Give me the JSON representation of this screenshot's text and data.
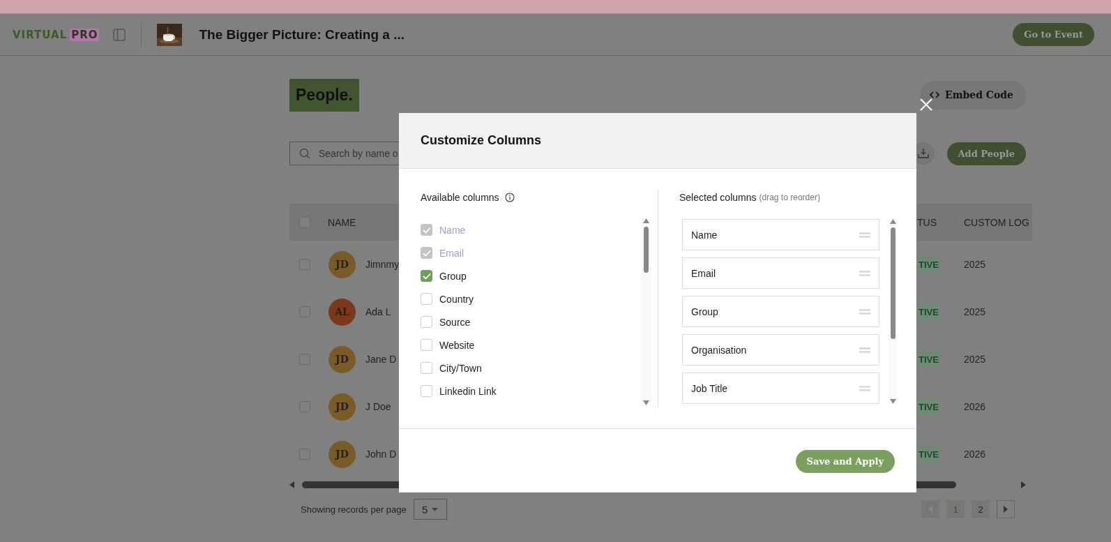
{
  "header": {
    "logo": {
      "primary": "VIRTUAL",
      "secondary": "PRO"
    },
    "event_title": "The Bigger Picture: Creating a ...",
    "go_to_event": "Go to Event"
  },
  "page": {
    "title": "People.",
    "embed_code": "Embed Code",
    "search": {
      "placeholder": "Search by name o"
    },
    "add_people": "Add People"
  },
  "table": {
    "select_all_checked": false,
    "columns": [
      "NAME",
      "TUS",
      "CUSTOM LOG"
    ],
    "rows": [
      {
        "checked": false,
        "initials": "JD",
        "name": "Jimnmy",
        "color": "#7a5a26",
        "status": "TIVE",
        "custom_log": "2025"
      },
      {
        "checked": false,
        "initials": "AL",
        "name": "Ada L",
        "color": "#7a391b",
        "status": "TIVE",
        "custom_log": "2025"
      },
      {
        "checked": false,
        "initials": "JD",
        "name": "Jane D",
        "color": "#7a5a26",
        "status": "TIVE",
        "custom_log": "2025"
      },
      {
        "checked": false,
        "initials": "JD",
        "name": "J Doe",
        "color": "#7a5a26",
        "status": "TIVE",
        "custom_log": "2026"
      },
      {
        "checked": false,
        "initials": "JD",
        "name": "John D",
        "color": "#7a5a26",
        "status": "TIVE",
        "custom_log": "2026"
      }
    ]
  },
  "pagination": {
    "label": "Showing records per page",
    "per_page": "5",
    "pages": [
      {
        "label": "1",
        "selected": true
      },
      {
        "label": "2",
        "selected": false
      }
    ]
  },
  "modal": {
    "title": "Customize Columns",
    "available": {
      "heading": "Available columns",
      "items": [
        {
          "label": "Name",
          "checked": true,
          "disabled": true
        },
        {
          "label": "Email",
          "checked": true,
          "disabled": true
        },
        {
          "label": "Group",
          "checked": true,
          "disabled": false
        },
        {
          "label": "Country",
          "checked": false,
          "disabled": false
        },
        {
          "label": "Source",
          "checked": false,
          "disabled": false
        },
        {
          "label": "Website",
          "checked": false,
          "disabled": false
        },
        {
          "label": "City/Town",
          "checked": false,
          "disabled": false
        },
        {
          "label": "Linkedin Link",
          "checked": false,
          "disabled": false
        }
      ]
    },
    "selected": {
      "heading": "Selected columns",
      "hint": "(drag to reorder)",
      "items": [
        "Name",
        "Email",
        "Group",
        "Organisation",
        "Job Title"
      ]
    },
    "save": "Save and Apply"
  }
}
